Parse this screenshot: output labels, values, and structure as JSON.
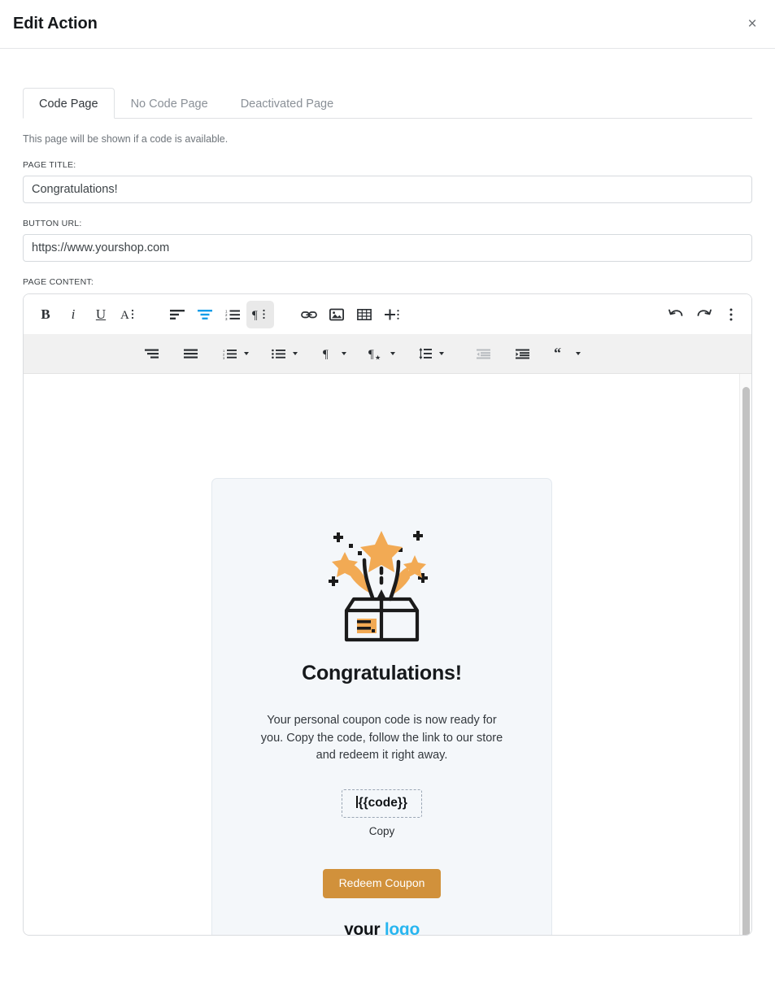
{
  "modal": {
    "title": "Edit Action",
    "close_icon": "close-icon",
    "close_label": "×"
  },
  "tabs": [
    {
      "label": "Code Page",
      "active": true
    },
    {
      "label": "No Code Page",
      "active": false
    },
    {
      "label": "Deactivated Page",
      "active": false
    }
  ],
  "hint": "This page will be shown if a code is available.",
  "fields": {
    "page_title": {
      "label": "PAGE TITLE:",
      "value": "Congratulations!",
      "placeholder": "Page title"
    },
    "button_url": {
      "label": "BUTTON URL:",
      "value": "https://www.yourshop.com",
      "placeholder": "Button URL"
    },
    "page_content": {
      "label": "PAGE CONTENT:"
    }
  },
  "toolbar": {
    "row1": [
      {
        "name": "bold-icon",
        "glyph": "B",
        "style": "bold"
      },
      {
        "name": "italic-icon",
        "glyph": "i",
        "style": "italic"
      },
      {
        "name": "underline-icon",
        "glyph": "U",
        "style": "underline"
      },
      {
        "name": "font-style-icon",
        "glyph": "A",
        "style": "menu"
      },
      {
        "name": "align-left-icon",
        "glyph": "",
        "style": "svg"
      },
      {
        "name": "align-center-icon",
        "glyph": "",
        "style": "svg-blue"
      },
      {
        "name": "ordered-list-icon",
        "glyph": "",
        "style": "svg"
      },
      {
        "name": "paragraph-format-icon",
        "glyph": "¶",
        "style": "menu-active"
      },
      {
        "name": "link-icon",
        "glyph": "",
        "style": "svg"
      },
      {
        "name": "image-icon",
        "glyph": "",
        "style": "svg"
      },
      {
        "name": "table-icon",
        "glyph": "",
        "style": "svg"
      },
      {
        "name": "insert-more-icon",
        "glyph": "+",
        "style": "menu"
      },
      {
        "name": "undo-icon",
        "glyph": "",
        "style": "svg"
      },
      {
        "name": "redo-icon",
        "glyph": "",
        "style": "svg"
      },
      {
        "name": "more-options-icon",
        "glyph": "⋮",
        "style": "svg"
      }
    ],
    "row2": [
      {
        "name": "align-right-icon"
      },
      {
        "name": "align-justify-icon"
      },
      {
        "name": "ordered-list-dropdown-icon"
      },
      {
        "name": "unordered-list-dropdown-icon"
      },
      {
        "name": "paragraph-style-dropdown-icon"
      },
      {
        "name": "paragraph-format-star-dropdown-icon"
      },
      {
        "name": "line-height-dropdown-icon"
      },
      {
        "name": "outdent-icon"
      },
      {
        "name": "indent-icon"
      },
      {
        "name": "blockquote-dropdown-icon"
      }
    ]
  },
  "scrollbar": {
    "name": "editor-vertical-scrollbar"
  },
  "preview": {
    "illustration": "gift-box-confetti-illustration",
    "heading": "Congratulations!",
    "paragraph": "Your personal coupon code is now ready for you. Copy the code, follow the link to our store and redeem it right away.",
    "code_placeholder": "{{code}}",
    "copy_label": "Copy",
    "redeem_button": "Redeem Coupon",
    "logo_primary": "your",
    "logo_accent": "logo"
  },
  "colors": {
    "accent_blue": "#119ce8",
    "button_orange": "#d1913b",
    "logo_cyan": "#28b6f0",
    "card_bg": "#f4f7fa",
    "illustration_orange": "#f2aa54"
  }
}
